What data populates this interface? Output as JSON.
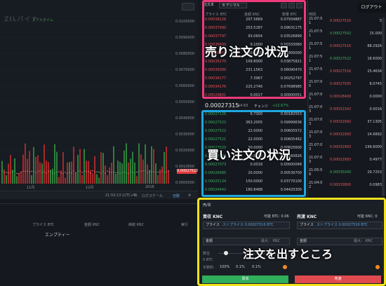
{
  "chart": {
    "pair_name": "ZILバイナ",
    "realtime_label": "リアルタイム",
    "price_ticks": [
      "0.0100000",
      "0.0090000",
      "0.0080000",
      "0.0070000",
      "0.0060000",
      "0.0050000",
      "0.0040000",
      "0.0030000",
      "0.0020000",
      "0.0010000",
      "0.0000000"
    ],
    "current_price": "0.00027522",
    "date_ticks": [
      "11月",
      "12月",
      "2018"
    ],
    "footer_time": "21:50:13 (UTC+9)",
    "footer_percent": "%",
    "footer_scale": "ログスケール",
    "footer_auto": "自動",
    "footer_gear": "gear-icon"
  },
  "order_book": {
    "tab_label": "注文本",
    "decimal_label": "8 デシマル",
    "head_price": "プライス BTC",
    "head_amount": "金額 KNC",
    "head_qty": "数量 BTC",
    "asks": [
      {
        "price": "0.00038228",
        "amount": "207.5669",
        "total": "0.07934887"
      },
      {
        "price": "0.00037990",
        "amount": "253.5187",
        "total": "0.09631175"
      },
      {
        "price": "0.00037797",
        "amount": "93.0654",
        "total": "0.03526899"
      },
      {
        "price": "0.00036600",
        "amount": "9.1000",
        "total": "0.00333060"
      },
      {
        "price": "0.00036000",
        "amount": "50.0000",
        "total": "0.01800000"
      },
      {
        "price": "0.00035270",
        "amount": "109.8000",
        "total": "0.03875821"
      },
      {
        "price": "0.00035000",
        "amount": "231.1563",
        "total": "0.08090470"
      },
      {
        "price": "0.00034177",
        "amount": "7.3967",
        "total": "0.00252797"
      },
      {
        "price": "0.00034176",
        "amount": "225.2746",
        "total": "0.07698985"
      },
      {
        "price": "0.00029801",
        "amount": "0.0017",
        "total": "0.00000051"
      }
    ],
    "last_price": "0.00027315",
    "last_usd": "$4.63",
    "change_label": "チェンジ",
    "change_value": "+22.67%",
    "bids": [
      {
        "price": "0.00027126",
        "amount": "6.7300",
        "total": "0.00182553"
      },
      {
        "price": "0.00027522",
        "amount": "363.2005",
        "total": "0.09999636"
      },
      {
        "price": "0.00027522",
        "amount": "22.0000",
        "total": "0.00605572"
      },
      {
        "price": "0.00027521",
        "amount": "22.0000",
        "total": "0.00605462"
      },
      {
        "price": "0.00027520",
        "amount": "30.0000",
        "total": "0.00825600"
      },
      {
        "price": "0.00027200",
        "amount": "20.6186",
        "total": "0.00560826"
      },
      {
        "price": "0.00027073",
        "amount": "0.0018",
        "total": "0.00000048"
      },
      {
        "price": "0.00026985",
        "amount": "20.0000",
        "total": "0.00539700"
      },
      {
        "price": "0.00025134",
        "amount": "150.0000",
        "total": "0.03770100"
      },
      {
        "price": "0.00024442",
        "amount": "180.8488",
        "total": "0.04420309"
      }
    ],
    "ask_overlay": "売り注文の状況",
    "bid_overlay": "買い注文の状況"
  },
  "trades": {
    "login_label": "ログアウト",
    "head_time": "時間",
    "rows": [
      {
        "time": "21:07:5\n1",
        "price": "0.00027516",
        "qty": "5",
        "side": "ask"
      },
      {
        "time": "21:07:5\n1",
        "price": "0.00027502",
        "qty": "15.000",
        "side": "bid"
      },
      {
        "time": "21:07:5\n1",
        "price": "0.00027516",
        "qty": "88.2926",
        "side": "ask"
      },
      {
        "time": "21:07:5\n1",
        "price": "0.00027522",
        "qty": "18.6000",
        "side": "bid"
      },
      {
        "time": "21:07:5\n1",
        "price": "0.00027516",
        "qty": "25.4634",
        "side": "ask"
      },
      {
        "time": "21:07:0\n5",
        "price": "0.00027505",
        "qty": "8.0745",
        "side": "ask"
      },
      {
        "time": "21:07:0\n5",
        "price": "0.00028400",
        "qty": "0.0000",
        "side": "ask"
      },
      {
        "time": "21:07:0\n3",
        "price": "0.00031342",
        "qty": "0.0016",
        "side": "ask"
      },
      {
        "time": "21:07:0\n3",
        "price": "0.00032992",
        "qty": "37.1305",
        "side": "ask"
      },
      {
        "time": "21:07:0\n3",
        "price": "0.00032993",
        "qty": "14.6892",
        "side": "ask"
      },
      {
        "time": "21:07:0\n3",
        "price": "0.00032993",
        "qty": "199.6000",
        "side": "ask"
      },
      {
        "time": "21:07:0\n3",
        "price": "0.00032993",
        "qty": "0.4977",
        "side": "ask"
      },
      {
        "time": "21:05:5\n9",
        "price": "0.00035000",
        "qty": "29.7253",
        "side": "bid"
      },
      {
        "time": "21:04:0\n2",
        "price": "0.00033800",
        "qty": "0.0983",
        "side": "ask"
      }
    ]
  },
  "open_orders": {
    "col_price": "プライス BTC",
    "col_amount": "金額 KNC",
    "col_filled": "締結 KNC",
    "col_real": "実行",
    "empty": "エンプティー"
  },
  "order_form": {
    "title": "売/買",
    "buy_title": "買収 KNC",
    "buy_available": "可能 BTC: 0.06",
    "sell_title": "売渡 KNC",
    "sell_available": "可能 KNC: 0",
    "price_label": "プライス",
    "buy_price_value": "ストプライス 0.00027516 BTC",
    "sell_price_value": "ストプライス 0.00027516 BTC",
    "amount_label": "金額",
    "max_label": "最大： KNC",
    "price_short": "数位",
    "amount_btc": "0 BTC",
    "fee_label": "手数料:",
    "fee_values": [
      "100%",
      "0.1%",
      "0.1%"
    ],
    "buy_button": "買収",
    "sell_button": "売渡",
    "overlay": "注文を出すところ"
  },
  "colors": {
    "ask": "#e8535b",
    "bid": "#3fae62",
    "pink_frame": "#ee3a7a",
    "blue_frame": "#1fa7e0",
    "yellow_frame": "#f3e21b"
  }
}
